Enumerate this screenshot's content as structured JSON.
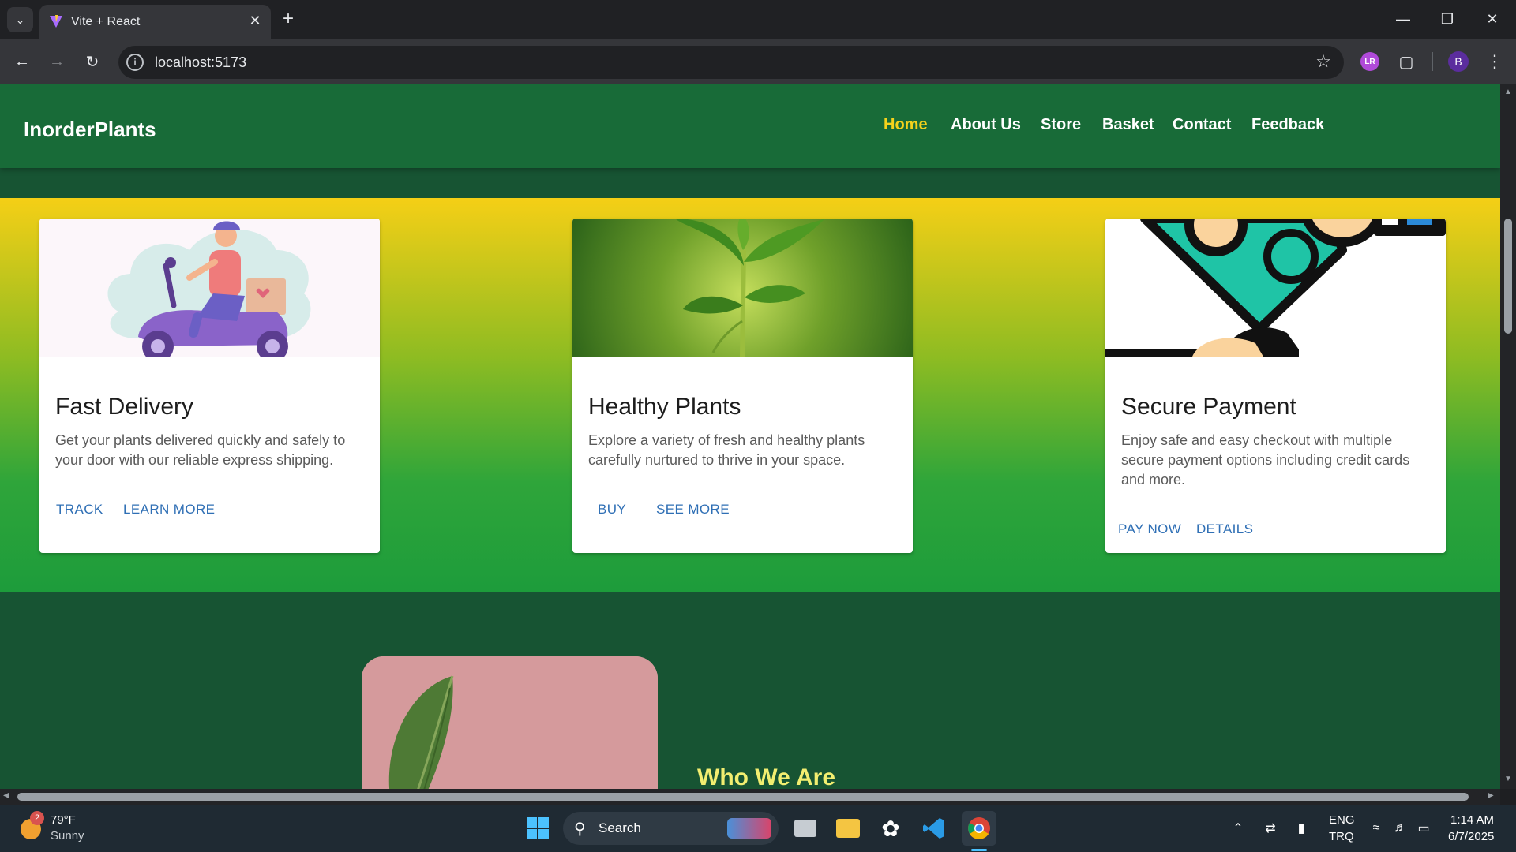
{
  "browser": {
    "tab_title": "Vite + React",
    "url": "localhost:5173",
    "profile_initial": "B",
    "extension_initials": "LR"
  },
  "site": {
    "brand": "InorderPlants",
    "nav": [
      "Home",
      "About Us",
      "Store",
      "Basket",
      "Contact",
      "Feedback"
    ],
    "active_nav": "Home",
    "colors": {
      "header_bg": "#186b38",
      "page_bg": "#175433",
      "active_link": "#f4d21c",
      "action_link": "#2f6fb5",
      "heading_yellow": "#f2ee70"
    },
    "cards": [
      {
        "title": "Fast Delivery",
        "description": "Get your plants delivered quickly and safely to your door with our reliable express shipping.",
        "actions": [
          "TRACK",
          "LEARN MORE"
        ],
        "image": "delivery-scooter-illustration"
      },
      {
        "title": "Healthy Plants",
        "description": "Explore a variety of fresh and healthy plants carefully nurtured to thrive in your space.",
        "actions": [
          "BUY",
          "SEE MORE"
        ],
        "image": "green-seedling-photo"
      },
      {
        "title": "Secure Payment",
        "description": "Enjoy safe and easy checkout with multiple secure payment options including credit cards and more.",
        "actions": [
          "PAY NOW",
          "DETAILS"
        ],
        "image": "card-payment-illustration"
      }
    ],
    "about_heading": "Who We Are"
  },
  "taskbar": {
    "weather_temp": "79°F",
    "weather_desc": "Sunny",
    "weather_badge": "2",
    "search_label": "Search",
    "lang_top": "ENG",
    "lang_bottom": "TRQ",
    "time": "1:14 AM",
    "date": "6/7/2025"
  }
}
